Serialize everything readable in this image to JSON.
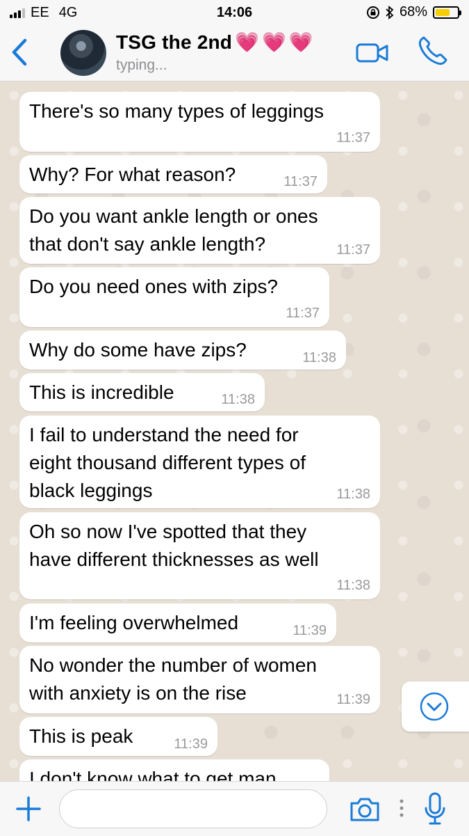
{
  "status_bar": {
    "carrier": "EE",
    "network": "4G",
    "time": "14:06",
    "battery_percent_label": "68%",
    "battery_level": 0.68,
    "icons": [
      "signal-bars-icon",
      "orientation-lock-icon",
      "bluetooth-icon",
      "battery-icon"
    ]
  },
  "header": {
    "back_icon": "chevron-left-icon",
    "contact_name": "TSG the 2nd",
    "contact_emoji": "💗💗💗",
    "status": "typing...",
    "video_icon": "video-camera-icon",
    "call_icon": "phone-icon"
  },
  "messages": [
    {
      "text": "There's so many types of leggings",
      "time": "11:37"
    },
    {
      "text": "Why? For what reason?",
      "time": "11:37"
    },
    {
      "text": "Do you want ankle length or ones\nthat don't say ankle length?",
      "time": "11:37"
    },
    {
      "text": "Do you need ones with zips?",
      "time": "11:37"
    },
    {
      "text": "Why do some have zips?",
      "time": "11:38"
    },
    {
      "text": "This is incredible",
      "time": "11:38"
    },
    {
      "text": "I fail to understand the need for\neight thousand different types of\nblack leggings",
      "time": "11:38"
    },
    {
      "text": "Oh so now I've spotted that they\nhave different thicknesses as well",
      "time": "11:38"
    },
    {
      "text": "I'm feeling overwhelmed",
      "time": "11:39"
    },
    {
      "text": "No wonder the number of women\nwith anxiety is on the rise",
      "time": "11:39"
    },
    {
      "text": "This is peak",
      "time": "11:39"
    },
    {
      "text": "I don't know what to get man",
      "time": ""
    }
  ],
  "scroll_down_icon": "chevron-down-circle-icon",
  "input_bar": {
    "plus_icon": "plus-icon",
    "message_value": "",
    "camera_icon": "camera-icon",
    "mic_icon": "microphone-icon"
  },
  "colors": {
    "accent": "#1a7bd7",
    "bubble": "#ffffff",
    "chat_background": "#e7dfd4",
    "timestamp": "#9a9a9a"
  }
}
